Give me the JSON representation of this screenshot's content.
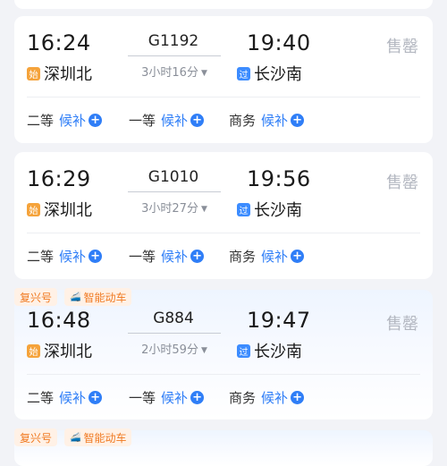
{
  "trains": [
    {
      "departure_time": "16:24",
      "train_no": "G1192",
      "duration": "3小时16分",
      "arrival_time": "19:40",
      "status": "售罄",
      "from_badge": "始",
      "from_station": "深圳北",
      "to_badge": "过",
      "to_station": "长沙南",
      "seats": [
        {
          "name": "二等",
          "availability": "候补"
        },
        {
          "name": "一等",
          "availability": "候补"
        },
        {
          "name": "商务",
          "availability": "候补"
        }
      ]
    },
    {
      "departure_time": "16:29",
      "train_no": "G1010",
      "duration": "3小时27分",
      "arrival_time": "19:56",
      "status": "售罄",
      "from_badge": "始",
      "from_station": "深圳北",
      "to_badge": "过",
      "to_station": "长沙南",
      "seats": [
        {
          "name": "二等",
          "availability": "候补"
        },
        {
          "name": "一等",
          "availability": "候补"
        },
        {
          "name": "商务",
          "availability": "候补"
        }
      ]
    },
    {
      "tags": [
        "复兴号",
        "智能动车"
      ],
      "departure_time": "16:48",
      "train_no": "G884",
      "duration": "2小时59分",
      "arrival_time": "19:47",
      "status": "售罄",
      "from_badge": "始",
      "from_station": "深圳北",
      "to_badge": "过",
      "to_station": "长沙南",
      "seats": [
        {
          "name": "二等",
          "availability": "候补"
        },
        {
          "name": "一等",
          "availability": "候补"
        },
        {
          "name": "商务",
          "availability": "候补"
        }
      ]
    },
    {
      "tags": [
        "复兴号",
        "智能动车"
      ]
    }
  ],
  "icons": {
    "plus": "+",
    "chevron": "▼",
    "train_tag": "🚄"
  },
  "colors": {
    "accent_blue": "#2f7ef7",
    "sold_out_gray": "#b3b7c0",
    "tag_orange": "#f07a22",
    "start_badge": "#f5a33b",
    "pass_badge": "#3c8cff"
  }
}
